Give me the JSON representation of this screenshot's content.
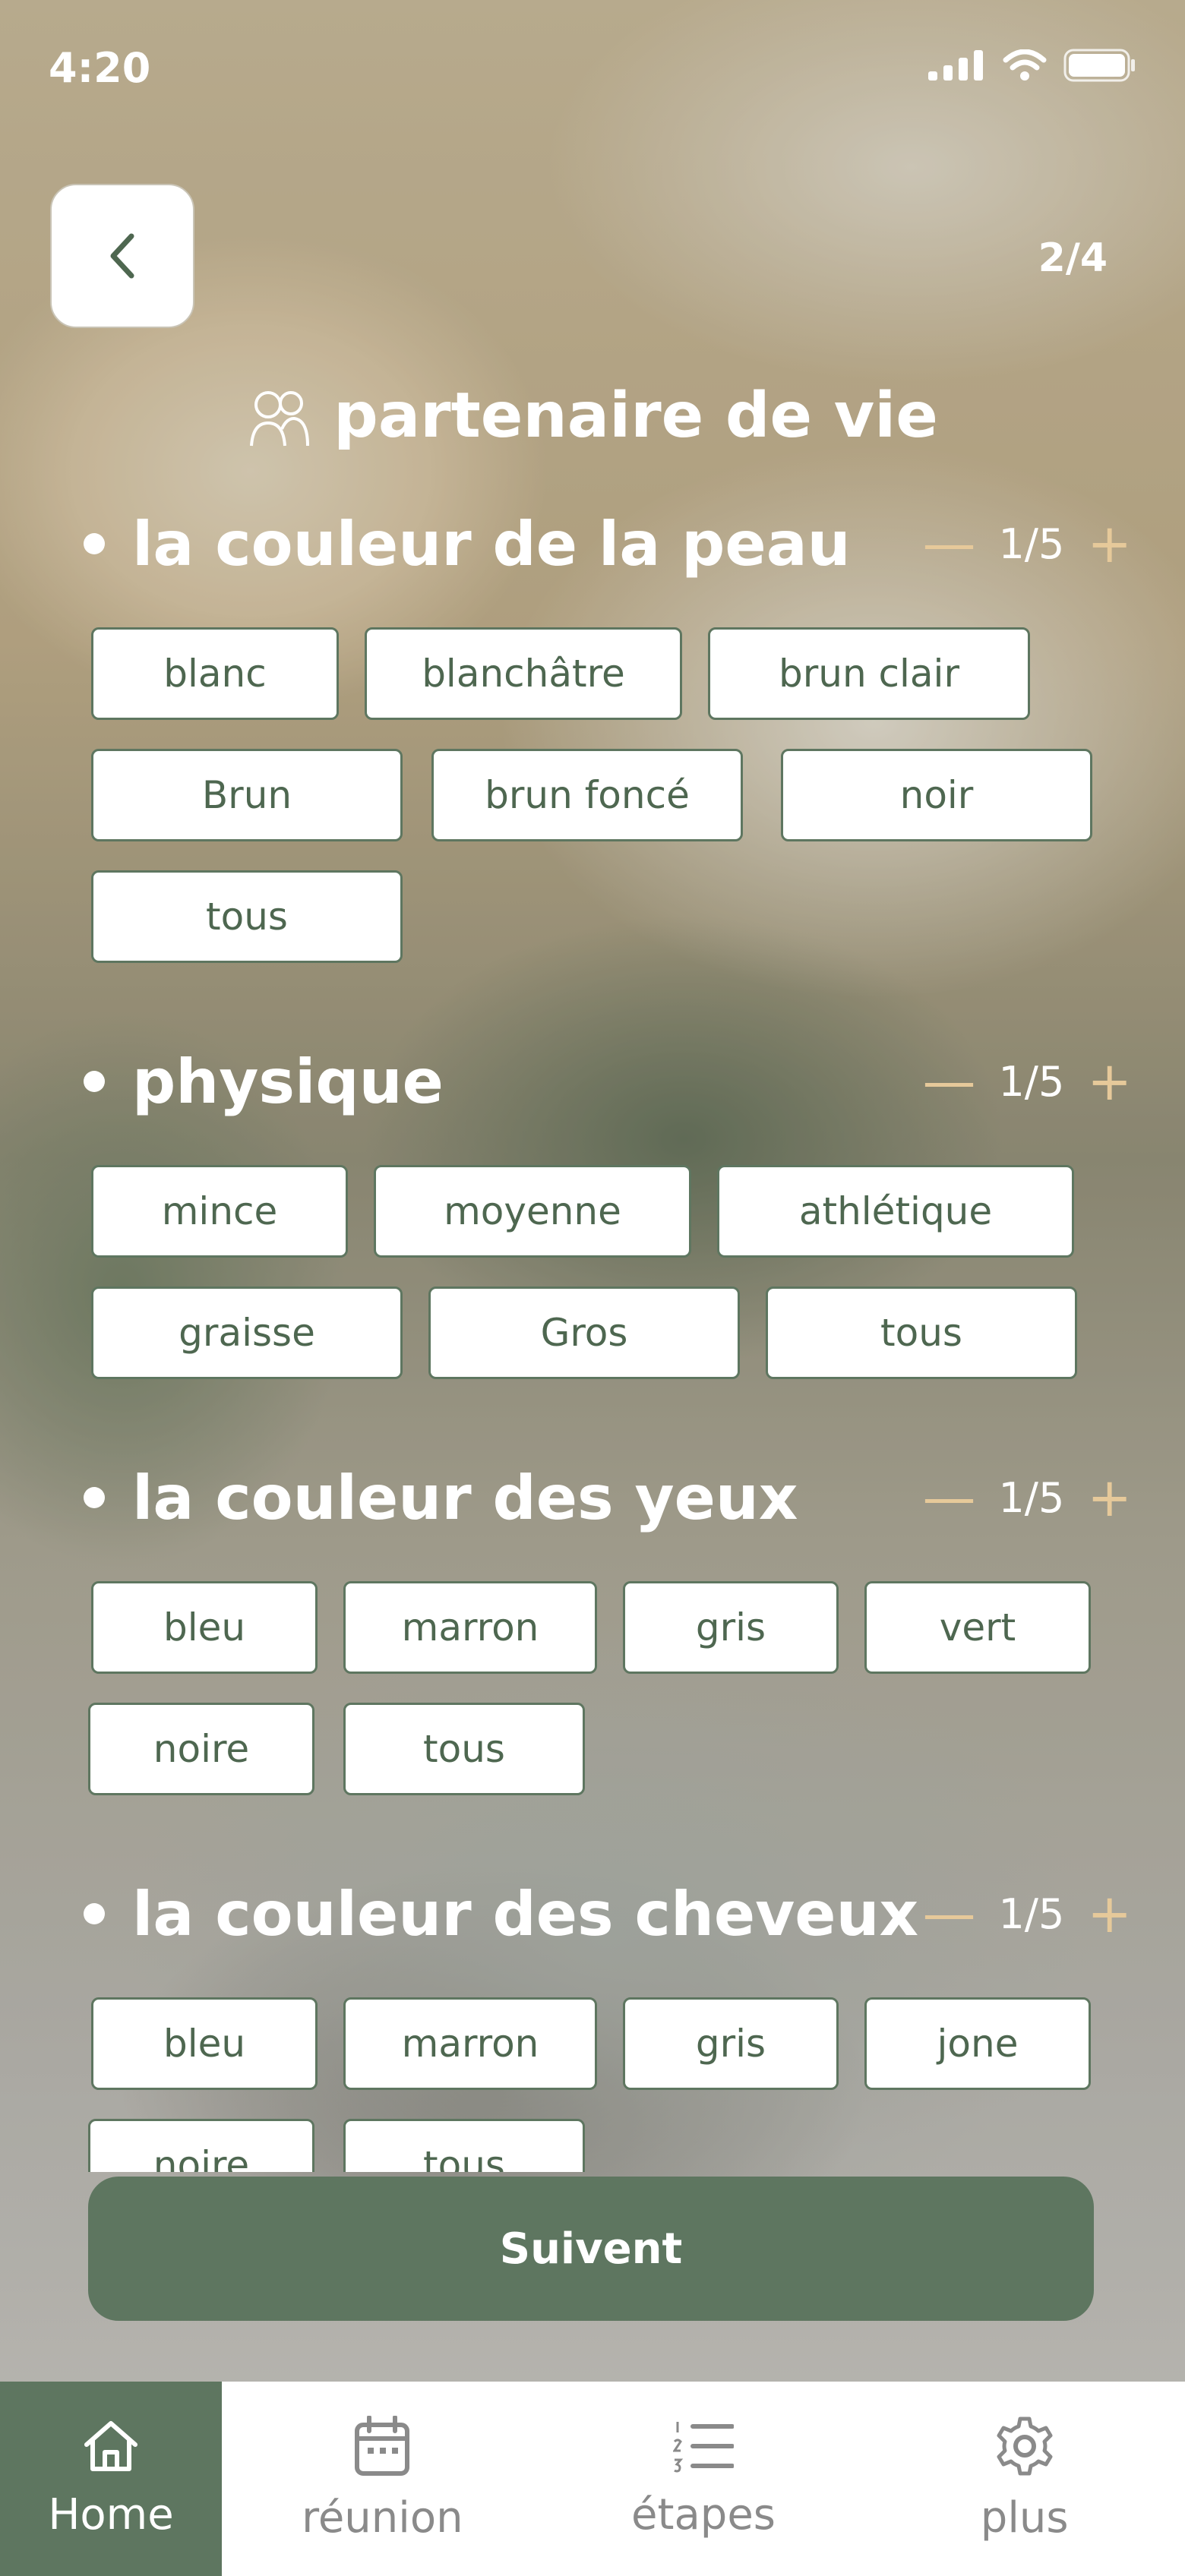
{
  "status_bar": {
    "time": "4:20"
  },
  "header": {
    "back_icon": "chevron-left-icon",
    "step": "2/4"
  },
  "title": {
    "icon": "couple-icon",
    "text": "partenaire de vie"
  },
  "sections": [
    {
      "title": "la couleur de la peau",
      "counter": "1/5",
      "options": [
        "blanc",
        "blanchâtre",
        "brun clair",
        "Brun",
        "brun foncé",
        "noir",
        "tous"
      ]
    },
    {
      "title": "physique",
      "counter": "1/5",
      "options": [
        "mince",
        "moyenne",
        "athlétique",
        "graisse",
        "Gros",
        "tous"
      ]
    },
    {
      "title": "la couleur des yeux",
      "counter": "1/5",
      "options": [
        "bleu",
        "marron",
        "gris",
        "vert",
        "noire",
        "tous"
      ]
    },
    {
      "title": "la couleur des cheveux",
      "counter": "1/5",
      "options": [
        "bleu",
        "marron",
        "gris",
        "jone",
        "noire",
        "tous"
      ]
    }
  ],
  "cta": {
    "label": "Suivent"
  },
  "tabs": [
    {
      "label": "Home",
      "icon": "home-icon"
    },
    {
      "label": "réunion",
      "icon": "calendar-icon"
    },
    {
      "label": "étapes",
      "icon": "list-icon"
    },
    {
      "label": "plus",
      "icon": "gear-icon"
    }
  ],
  "colors": {
    "accent": "#5e7660",
    "counter_controls": "#e6c99a",
    "chip_text": "#4e6750"
  }
}
